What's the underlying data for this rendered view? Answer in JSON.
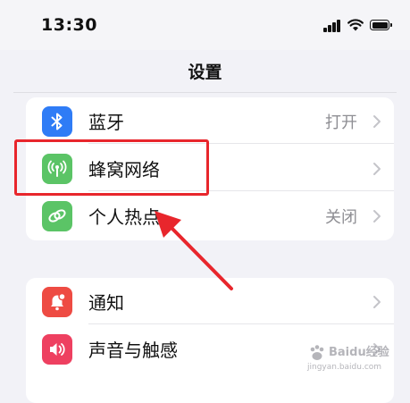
{
  "status_bar": {
    "time": "13:30",
    "icons": [
      "cellular-signal-icon",
      "wifi-icon",
      "battery-icon"
    ]
  },
  "nav": {
    "title": "设置"
  },
  "groups": [
    {
      "items": [
        {
          "label": "蓝牙",
          "value": "打开",
          "icon": "bluetooth-icon",
          "color": "#2f7cf6"
        },
        {
          "label": "蜂窝网络",
          "value": "",
          "icon": "cellular-antenna-icon",
          "color": "#5bc466"
        },
        {
          "label": "个人热点",
          "value": "关闭",
          "icon": "hotspot-link-icon",
          "color": "#5bc466"
        }
      ]
    },
    {
      "items": [
        {
          "label": "通知",
          "value": "",
          "icon": "notification-bell-icon",
          "color": "#ee4b43"
        },
        {
          "label": "声音与触感",
          "value": "",
          "icon": "speaker-icon",
          "color": "#ee4060"
        }
      ]
    }
  ],
  "annotation": {
    "highlight_color": "#e8262c",
    "arrow_color": "#e8262c"
  },
  "watermark": {
    "text": "Baidu经验",
    "url": "jingyan.baidu.com"
  }
}
